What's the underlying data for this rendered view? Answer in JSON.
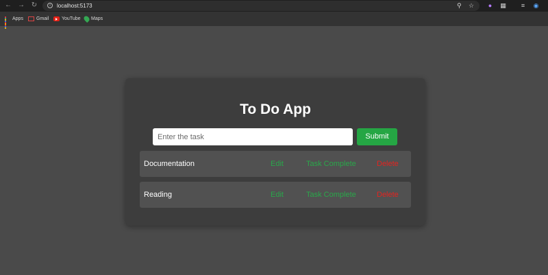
{
  "browser": {
    "url": "localhost:5173",
    "bookmarks": [
      {
        "label": "Apps"
      },
      {
        "label": "Gmail"
      },
      {
        "label": "YouTube"
      },
      {
        "label": "Maps"
      }
    ]
  },
  "app": {
    "title": "To Do App",
    "input_placeholder": "Enter the task",
    "input_value": "",
    "submit_label": "Submit",
    "tasks": [
      {
        "name": "Documentation",
        "edit": "Edit",
        "complete": "Task Complete",
        "delete": "Delete"
      },
      {
        "name": "Reading",
        "edit": "Edit",
        "complete": "Task Complete",
        "delete": "Delete"
      }
    ]
  },
  "colors": {
    "page_bg": "#4a4a4a",
    "card_bg": "#3d3d3d",
    "row_bg": "#515151",
    "accent_green": "#25a644",
    "delete_red": "#e5231f"
  }
}
